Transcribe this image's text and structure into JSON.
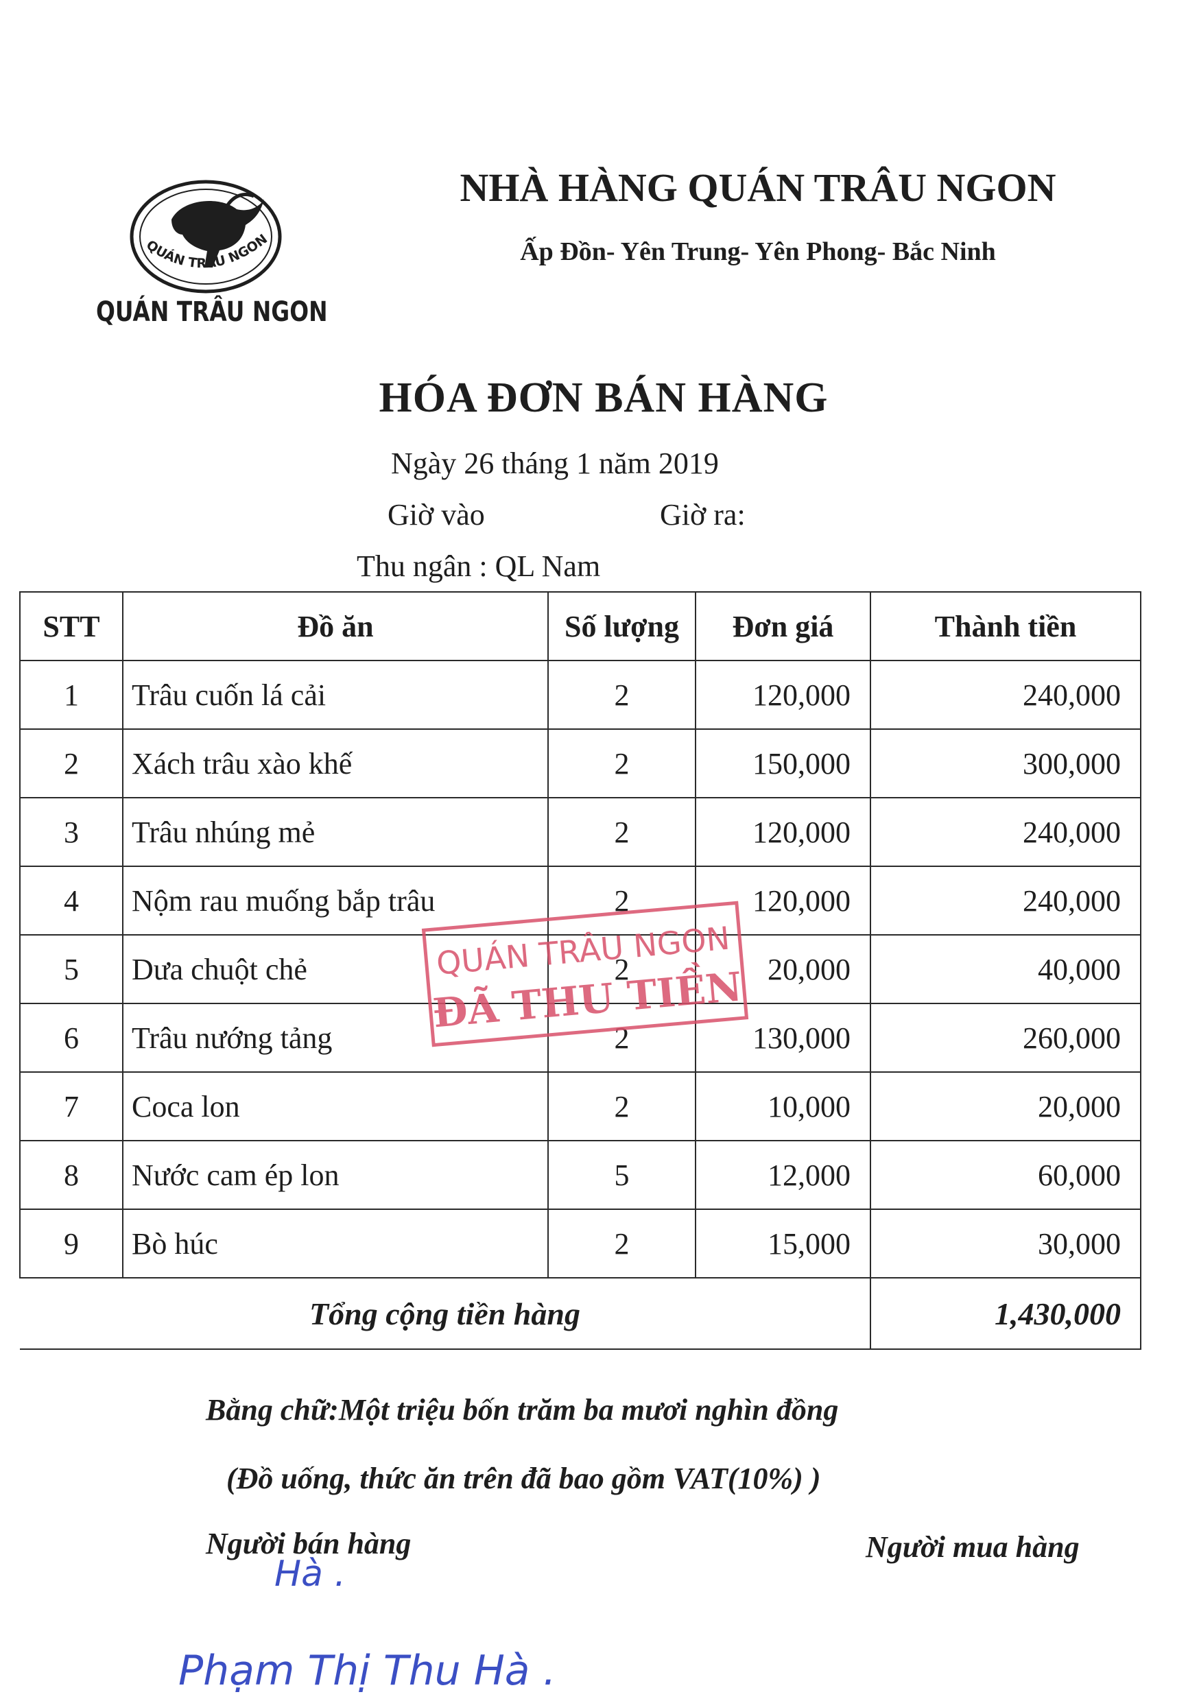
{
  "logo": {
    "ring_text": "QUÁN TRÂU NGON",
    "caption": "QUÁN TRÂU NGON"
  },
  "header": {
    "restaurant_name": "NHÀ HÀNG QUÁN TRÂU NGON",
    "address": "Ấp Đồn- Yên Trung- Yên Phong- Bắc Ninh"
  },
  "invoice": {
    "title": "HÓA ĐƠN BÁN HÀNG",
    "date_line": "Ngày 26  tháng 1 năm 2019",
    "time_in_label": "Giờ vào",
    "time_out_label": "Giờ ra:",
    "cashier_line": "Thu ngân : QL Nam"
  },
  "table": {
    "columns": [
      "STT",
      "Đồ ăn",
      "Số lượng",
      "Đơn giá",
      "Thành tiền"
    ],
    "rows": [
      {
        "stt": "1",
        "name": "Trâu cuốn lá cải",
        "qty": "2",
        "price": "120,000",
        "amount": "240,000"
      },
      {
        "stt": "2",
        "name": "Xách trâu xào khế",
        "qty": "2",
        "price": "150,000",
        "amount": "300,000"
      },
      {
        "stt": "3",
        "name": "Trâu nhúng mẻ",
        "qty": "2",
        "price": "120,000",
        "amount": "240,000"
      },
      {
        "stt": "4",
        "name": "Nộm rau muống bắp trâu",
        "qty": "2",
        "price": "120,000",
        "amount": "240,000"
      },
      {
        "stt": "5",
        "name": "Dưa chuột chẻ",
        "qty": "2",
        "price": "20,000",
        "amount": "40,000"
      },
      {
        "stt": "6",
        "name": "Trâu nướng tảng",
        "qty": "2",
        "price": "130,000",
        "amount": "260,000"
      },
      {
        "stt": "7",
        "name": "Coca lon",
        "qty": "2",
        "price": "10,000",
        "amount": "20,000"
      },
      {
        "stt": "8",
        "name": "Nước cam ép lon",
        "qty": "5",
        "price": "12,000",
        "amount": "60,000"
      },
      {
        "stt": "9",
        "name": "Bò húc",
        "qty": "2",
        "price": "15,000",
        "amount": "30,000"
      }
    ],
    "total_label": "Tổng cộng tiền hàng",
    "total_value": "1,430,000"
  },
  "footer": {
    "amount_in_words": "Bằng chữ:Một triệu bốn trăm ba mươi nghìn đồng",
    "vat_note": "(Đồ uống, thức ăn trên đã bao gồm VAT(10%) )",
    "seller_label": "Người bán hàng",
    "buyer_label": "Người mua hàng"
  },
  "stamp": {
    "line1": "QUÁN TRÂU NGON",
    "line2": "ĐÃ THU TIỀN",
    "color": "#d8506a"
  },
  "signature": {
    "initials": "Hà .",
    "full_name": "Phạm Thị Thu Hà ."
  },
  "colors": {
    "ink": "#1e1e1e",
    "signature_ink": "#3b4fc4"
  }
}
